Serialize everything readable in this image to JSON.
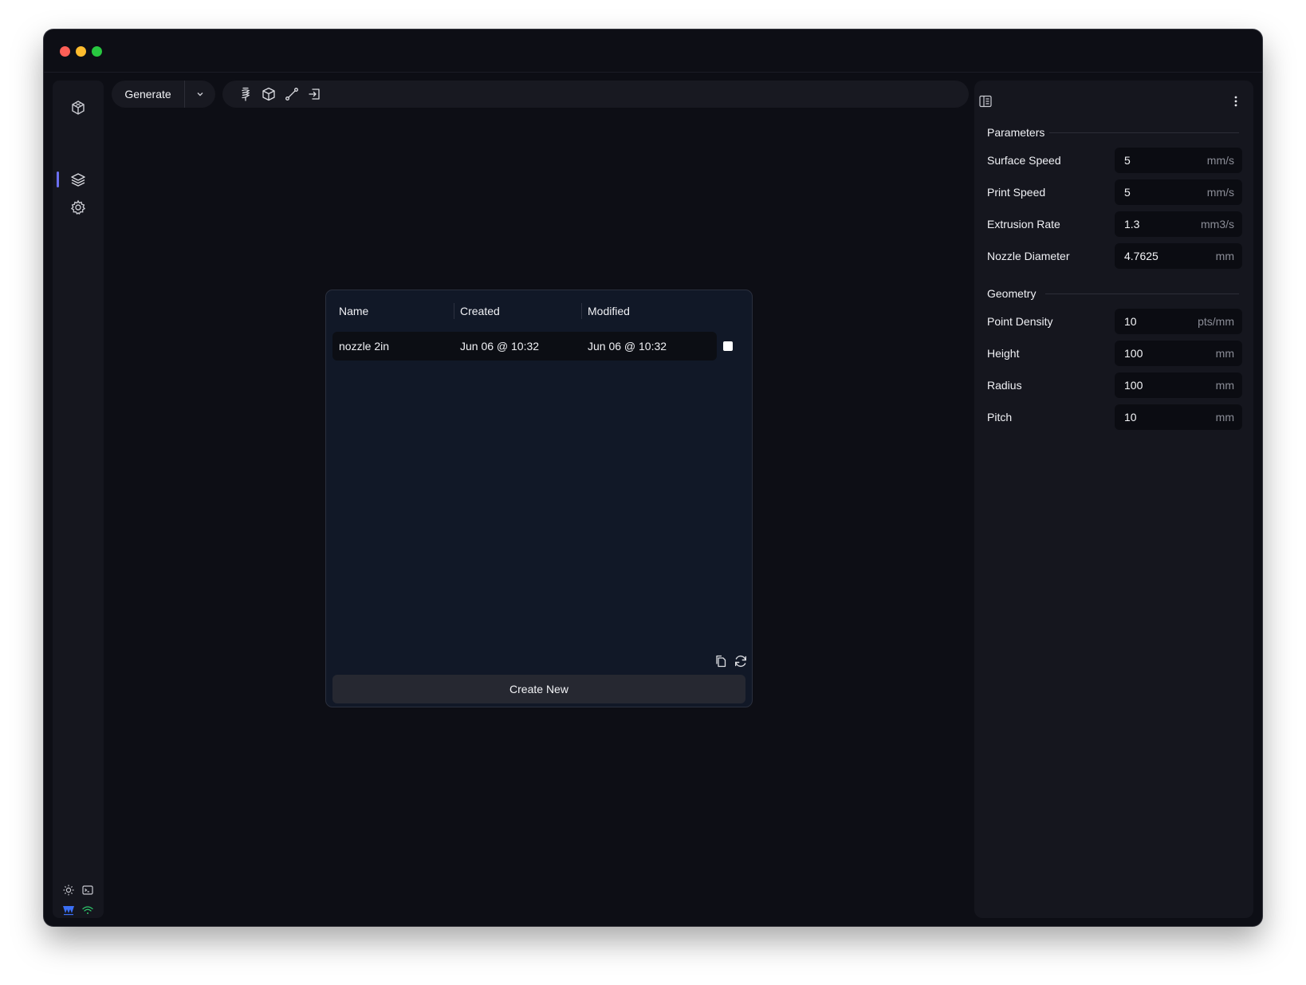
{
  "toolbar": {
    "generate_label": "Generate",
    "tool_icons": [
      "spring-icon",
      "cube-icon",
      "line-tool-icon",
      "export-icon"
    ]
  },
  "sidebar": {
    "items": [
      {
        "icon": "cube-outline-icon",
        "active": false
      },
      {
        "icon": "layers-icon",
        "active": true
      },
      {
        "icon": "settings-icon",
        "active": false
      }
    ],
    "bottom_icons": [
      "sun-icon",
      "terminal-icon",
      "logo-icon",
      "wifi-icon"
    ],
    "accent_color": "#6b6ff0"
  },
  "files_dialog": {
    "columns": {
      "name": "Name",
      "created": "Created",
      "modified": "Modified"
    },
    "rows": [
      {
        "name": "nozzle 2in",
        "created": "Jun 06 @ 10:32",
        "modified": "Jun 06 @ 10:32",
        "selected": true
      }
    ],
    "create_label": "Create New",
    "actions": [
      "copy-icon",
      "refresh-icon"
    ]
  },
  "panel": {
    "sections": [
      {
        "title": "Parameters",
        "fields": [
          {
            "label": "Surface Speed",
            "value": "5",
            "unit": "mm/s"
          },
          {
            "label": "Print Speed",
            "value": "5",
            "unit": "mm/s"
          },
          {
            "label": "Extrusion Rate",
            "value": "1.3",
            "unit": "mm3/s"
          },
          {
            "label": "Nozzle Diameter",
            "value": "4.7625",
            "unit": "mm"
          }
        ]
      },
      {
        "title": "Geometry",
        "fields": [
          {
            "label": "Point Density",
            "value": "10",
            "unit": "pts/mm"
          },
          {
            "label": "Height",
            "value": "100",
            "unit": "mm"
          },
          {
            "label": "Radius",
            "value": "100",
            "unit": "mm"
          },
          {
            "label": "Pitch",
            "value": "10",
            "unit": "mm"
          }
        ]
      }
    ]
  }
}
